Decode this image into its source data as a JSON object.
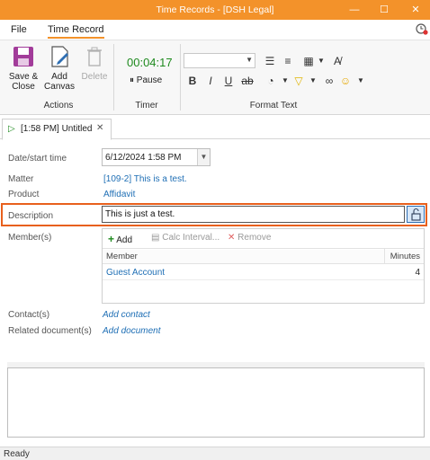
{
  "window": {
    "title": "Time Records - [DSH Legal]",
    "controls": {
      "minimize": "—",
      "maximize": "☐",
      "close": "✕"
    }
  },
  "menu": {
    "tabs": [
      "File",
      "Time Record"
    ],
    "active": "Time Record"
  },
  "ribbon": {
    "actions": {
      "save_close": "Save &\nClose",
      "add_canvas": "Add\nCanvas",
      "delete": "Delete",
      "group_label": "Actions"
    },
    "timer": {
      "value": "00:04:17",
      "pause_label": "Pause",
      "group_label": "Timer"
    },
    "format_text": {
      "group_label": "Format Text",
      "font_combo_value": "",
      "icons": [
        "bold-icon",
        "italic-icon",
        "underline-icon",
        "strikethrough-icon",
        "bullets-icon",
        "numbering-icon",
        "table-icon",
        "clear-format-icon",
        "color-icon",
        "highlight-icon",
        "link-icon",
        "emoji-icon"
      ]
    }
  },
  "doc_tab": {
    "label": "[1:58 PM] Untitled",
    "close": "✕"
  },
  "form": {
    "date_label": "Date/start time",
    "date_value": "6/12/2024 1:58 PM",
    "matter_label": "Matter",
    "matter_value": "[109-2] This is a test.",
    "product_label": "Product",
    "product_value": "Affidavit",
    "description_label": "Description",
    "description_value": "This is just a test.",
    "members_label": "Member(s)",
    "members": {
      "add_label": "Add",
      "calc_label": "Calc Interval...",
      "remove_label": "Remove",
      "columns": [
        "Member",
        "Minutes"
      ],
      "rows": [
        {
          "member": "Guest Account",
          "minutes": "4"
        }
      ]
    },
    "contacts_label": "Contact(s)",
    "contacts_link": "Add contact",
    "related_label": "Related document(s)",
    "related_link": "Add document"
  },
  "status": {
    "text": "Ready"
  },
  "colors": {
    "accent": "#f3922a",
    "highlight": "#e8601d",
    "link": "#1f6fb5",
    "timer": "#1e8a1e"
  }
}
